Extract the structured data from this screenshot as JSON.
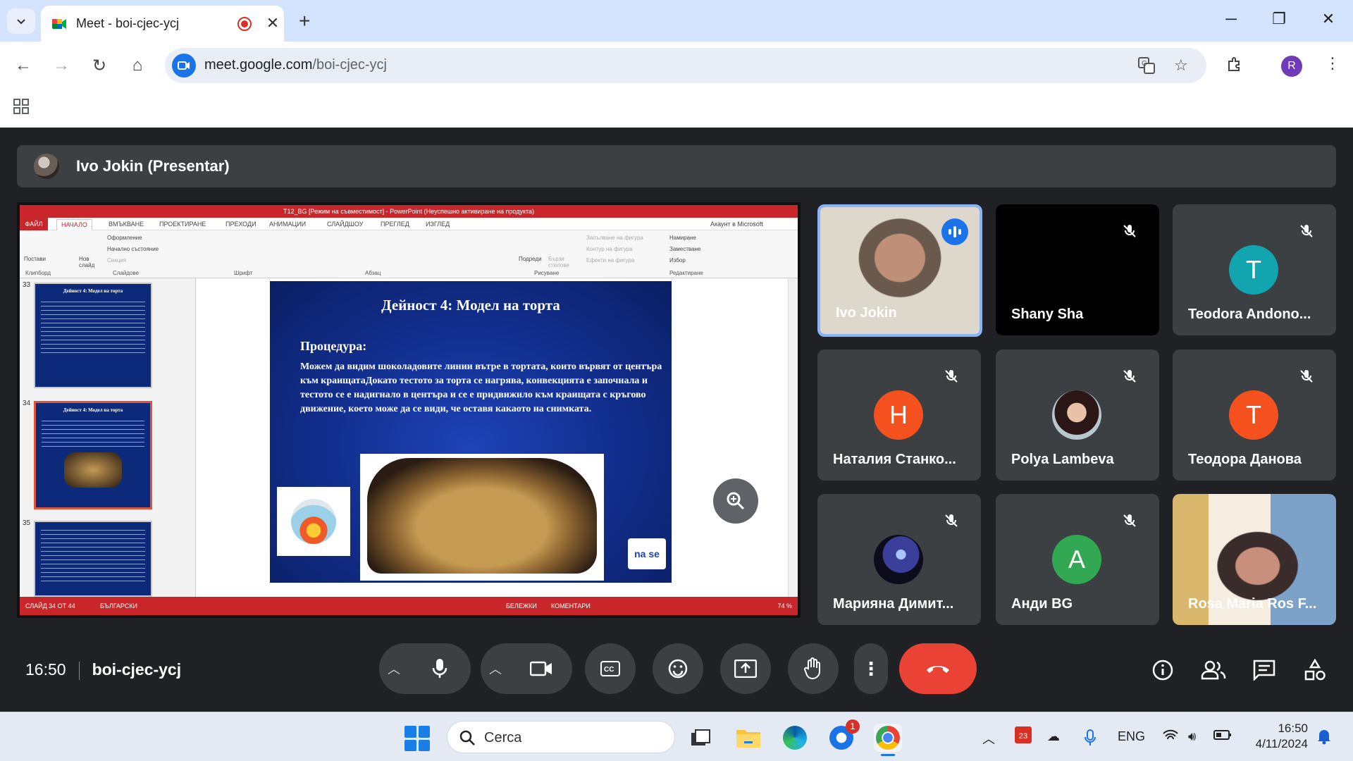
{
  "browser": {
    "tab_title": "Meet - boi-cjec-ycj",
    "url_host": "meet.google.com",
    "url_path": "/boi-cjec-ycj",
    "profile_initial": "R",
    "new_tab": "+",
    "close": "✕"
  },
  "meet": {
    "presenter_label": "Ivo Jokin (Presentar)",
    "time": "16:50",
    "room_code": "boi-cjec-ycj"
  },
  "presentation": {
    "titlebar": "T12_BG [Режим на съвместимост] - PowerPoint (Неуспешно активиране на продукта)",
    "account": "Акаунт в Microsoft",
    "menu": [
      "ФАЙЛ",
      "НАЧАЛО",
      "ВМЪКВАНЕ",
      "ПРОЕКТИРАНЕ",
      "ПРЕХОДИ",
      "АНИМАЦИИ",
      "СЛАЙДШОУ",
      "ПРЕГЛЕД",
      "ИЗГЛЕД"
    ],
    "ribbon_groups": [
      "Клипборд",
      "Слайдове",
      "Шрифт",
      "Абзац",
      "Рисуване",
      "Редактиране"
    ],
    "ribbon_items": {
      "paste": "Постави",
      "new_slide": "Нов слайд",
      "layout": "Оформление",
      "reset": "Начално състояние",
      "section": "Секция",
      "arrange": "Подреди",
      "quick_styles": "Бързи стилове",
      "shape_fill": "Запълване на фигура",
      "shape_outline": "Контур на фигура",
      "shape_effects": "Ефекти на фигура",
      "find": "Намиране",
      "replace": "Заместване",
      "select": "Избор"
    },
    "thumb_numbers": [
      "33",
      "34",
      "35"
    ],
    "thumb_title": "Дейност 4: Модел на торта",
    "slide": {
      "title": "Дейност 4: Модел на торта",
      "procedure": "Процедура:",
      "body": "Можем да видим шоколадовите линии вътре в тортата, които вървят от центъра към краищатаДокато тестото за торта се нагрява, конвекцията е започнала и тестото се е надигнало в центъра и се е придвижило към краищата с кръгово движение, което може да се види, че оставя какаото на снимката.",
      "logo": "na se"
    },
    "status": {
      "slide": "СЛАЙД 34 ОТ 44",
      "lang": "БЪЛГАРСКИ",
      "notes": "БЕЛЕЖКИ",
      "comments": "КОМЕНТАРИ",
      "zoom": "74 %"
    }
  },
  "participants": [
    {
      "name": "Ivo Jokin",
      "type": "video",
      "speaking": true
    },
    {
      "name": "Shany Sha",
      "type": "blank",
      "muted": true
    },
    {
      "name": "Teodora Andono...",
      "type": "letter",
      "letter": "T",
      "color": "#12a4af",
      "muted": true
    },
    {
      "name": "Наталия Станко...",
      "type": "letter",
      "letter": "H",
      "color": "#f4511e",
      "muted": true
    },
    {
      "name": "Polya Lambeva",
      "type": "photo",
      "muted": true
    },
    {
      "name": "Теодора Данова",
      "type": "letter",
      "letter": "T",
      "color": "#f4511e",
      "muted": true
    },
    {
      "name": "Марияна Димит...",
      "type": "photo",
      "muted": true
    },
    {
      "name": "Анди BG",
      "type": "letter",
      "letter": "A",
      "color": "#33a852",
      "muted": true
    },
    {
      "name": "Rosa Maria Ros F...",
      "type": "video"
    }
  ],
  "taskbar": {
    "search_placeholder": "Cerca",
    "lang": "ENG",
    "time": "16:50",
    "date": "4/11/2024",
    "calendar_day": "23",
    "badge": "1"
  }
}
